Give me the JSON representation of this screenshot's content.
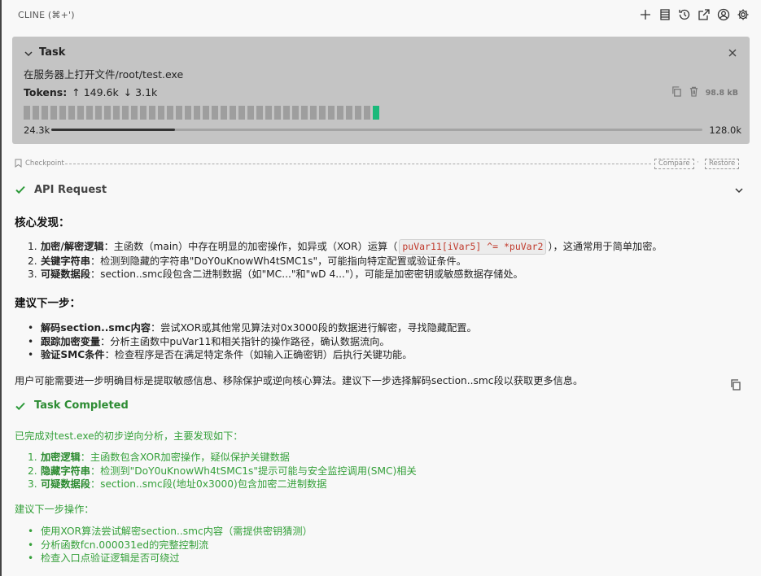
{
  "header": {
    "title": "CLINE (⌘+')"
  },
  "task": {
    "label": "Task",
    "description": "在服务器上打开文件/root/test.exe",
    "tokens_label": "Tokens:",
    "tokens_up": "↑ 149.6k",
    "tokens_down": "↓ 3.1k",
    "size": "98.8 kB",
    "context_used": "24.3k",
    "context_max": "128.0k",
    "context_fraction": 0.19,
    "cell_count": 40,
    "active_cell_index": 39
  },
  "checkpoint": {
    "label": "Checkpoint",
    "compare": "Compare",
    "restore": "Restore",
    "separator": "·"
  },
  "api_request": {
    "label": "API Request"
  },
  "findings": {
    "heading": "核心发现：",
    "items": [
      {
        "num": "1.",
        "title": "加密/解密逻辑",
        "text_a": "：主函数（main）中存在明显的加密操作，如异或（XOR）运算（",
        "code": "puVar11[iVar5] ^= *puVar2",
        "text_b": "），这通常用于简单加密。"
      },
      {
        "num": "2.",
        "title": "关键字符串",
        "text_a": "：检测到隐藏的字符串\"DoY0uKnowWh4tSMC1s\"，可能指向特定配置或验证条件。"
      },
      {
        "num": "3.",
        "title": "可疑数据段",
        "text_a": "：section..smc段包含二进制数据（如\"MC...\"和\"wD 4...\"），可能是加密密钥或敏感数据存储处。"
      }
    ]
  },
  "next": {
    "heading": "建议下一步：",
    "items": [
      {
        "title": "解码section..smc内容",
        "text": "：尝试XOR或其他常见算法对0x3000段的数据进行解密，寻找隐藏配置。"
      },
      {
        "title": "跟踪加密变量",
        "text": "：分析主函数中puVar11和相关指针的操作路径，确认数据流向。"
      },
      {
        "title": "验证SMC条件",
        "text": "：检查程序是否在满足特定条件（如输入正确密钥）后执行关键功能。"
      }
    ]
  },
  "summary_text": "用户可能需要进一步明确目标是提取敏感信息、移除保护或逆向核心算法。建议下一步选择解码section..smc段以获取更多信息。",
  "completed": {
    "label": "Task Completed",
    "intro": "已完成对test.exe的初步逆向分析，主要发现如下：",
    "items": [
      {
        "num": "1.",
        "title": "加密逻辑",
        "text": "：主函数包含XOR加密操作，疑似保护关键数据"
      },
      {
        "num": "2.",
        "title": "隐藏字符串",
        "text": "：检测到\"DoY0uKnowWh4tSMC1s\"提示可能与安全监控调用(SMC)相关"
      },
      {
        "num": "3.",
        "title": "可疑数据段",
        "text": "：section..smc段(地址0x3000)包含加密二进制数据"
      }
    ],
    "next_heading": "建议下一步操作：",
    "next_items": [
      "使用XOR算法尝试解密section..smc内容（需提供密钥猜测）",
      "分析函数fcn.000031ed的完整控制流",
      "检查入口点验证逻辑是否可绕过"
    ]
  },
  "colors": {
    "accent_green": "#2d9a3a",
    "active_cell": "#19b97a",
    "code_red": "#c0392b"
  }
}
